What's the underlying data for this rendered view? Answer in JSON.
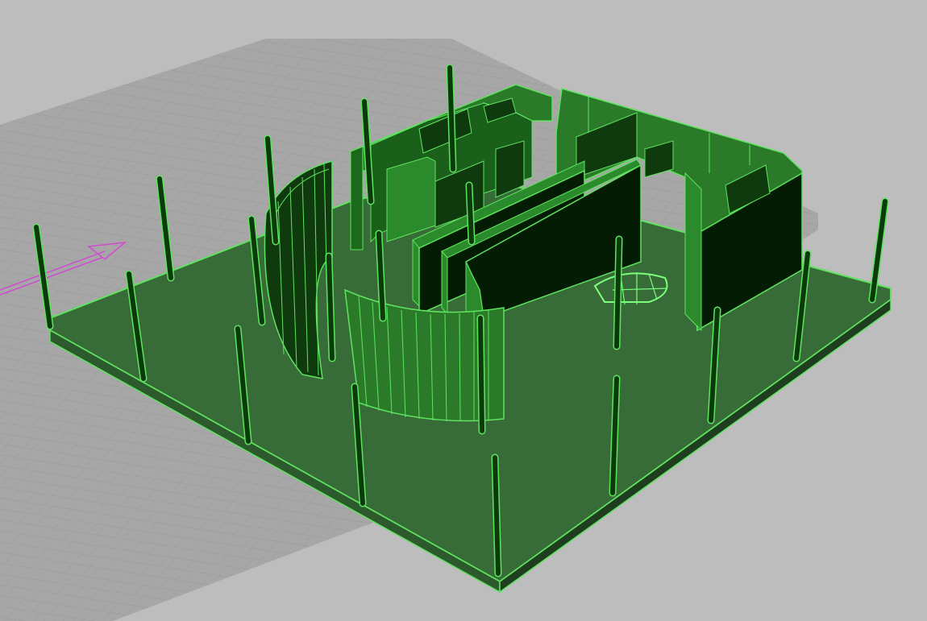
{
  "viewport": {
    "title": "",
    "background": "#bdbdbd",
    "grid_color": "#a9a9a9",
    "grid_plane_color": "#9e9e9e",
    "axis_color": "#d24ad2"
  },
  "model": {
    "base_fill": "#376b37",
    "base_edge": "#5fe35f",
    "wall_side_fill": "#2a7a2a",
    "wall_front_fill": "#0e2f0e",
    "wall_dark_fill": "#041c04",
    "column_fill": "#0b3a0b",
    "edge_color": "#5fe35f",
    "highlight_color": "#7bff7b"
  }
}
